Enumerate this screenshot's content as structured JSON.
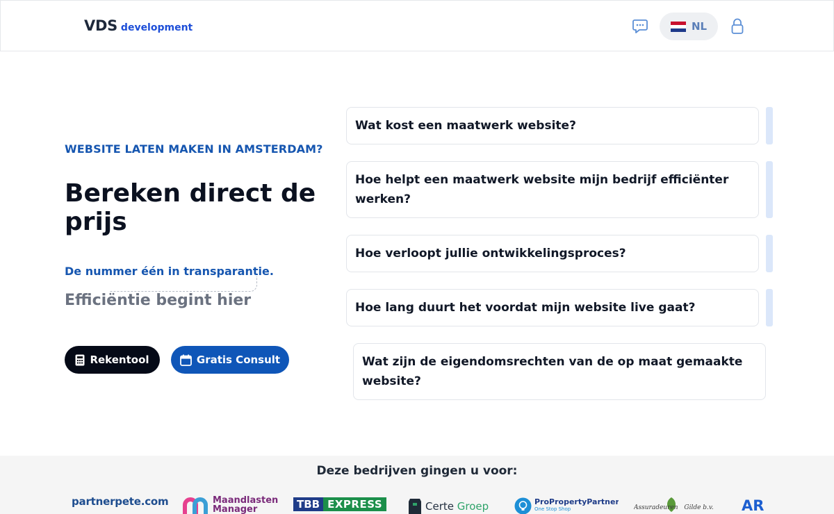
{
  "header": {
    "logo_main": "VDS",
    "logo_sub": "development",
    "language": "NL"
  },
  "hero": {
    "eyebrow": "WEBSITE LATEN MAKEN IN AMSTERDAM?",
    "title": "Bereken direct de prijs",
    "tagline": "De nummer één in transparantie.",
    "typewriter": "Efficiëntie begint hier",
    "buttons": {
      "calculator": "Rekentool",
      "consult": "Gratis Consult"
    }
  },
  "faq": [
    "Wat kost een maatwerk website?",
    "Hoe helpt een maatwerk website mijn bedrijf efficiënter werken?",
    "Hoe verloopt jullie ontwikkelingsproces?",
    "Hoe lang duurt het voordat mijn website live gaat?",
    "Wat zijn de eigendomsrechten van de op maat gemaakte website?"
  ],
  "partners": {
    "title": "Deze bedrijven gingen u voor:",
    "logos": {
      "partnerpete": "partnerpete.com",
      "maandlasten_1": "Maandlasten",
      "maandlasten_2": "Manager",
      "tbb_1": "TBB",
      "tbb_2": "EXPRESS",
      "certe_1": "Certe",
      "certe_2": "Groep",
      "propp": "ProPropertyPartners",
      "propp_sub": "One Stop Shop",
      "assur_1": "Assuradeuren",
      "assur_2": "Gilde b.v.",
      "ar": "AR"
    }
  },
  "colors": {
    "accent_blue": "#1656b0",
    "dark_button": "#050a17",
    "blue_button": "#0f56b8"
  }
}
